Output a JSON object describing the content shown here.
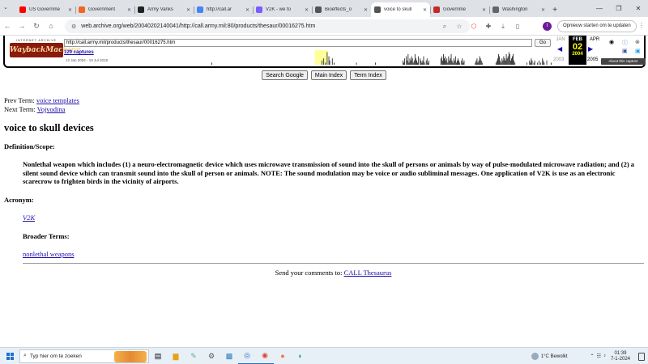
{
  "browser": {
    "tabs": [
      {
        "title": "US Governme",
        "color": "#ff0000",
        "active": false
      },
      {
        "title": "Government",
        "color": "#f26522",
        "active": false
      },
      {
        "title": "Army Vanks",
        "color": "#222222",
        "active": false
      },
      {
        "title": "http://call.ar",
        "color": "#4285f4",
        "active": false
      },
      {
        "title": "V2K - we to",
        "color": "#7b5cff",
        "active": false
      },
      {
        "title": "Bioeffects_o",
        "color": "#555555",
        "active": false
      },
      {
        "title": "voice to skull",
        "color": "#555555",
        "active": true
      },
      {
        "title": "Governme",
        "color": "#c62828",
        "active": false
      },
      {
        "title": "Washington",
        "color": "#666666",
        "active": false
      }
    ],
    "new_tab": "+",
    "address": "web.archive.org/web/20040202140041/http://call.army.mil:80/products/thesaur/00016275.htm",
    "update_button": "Opnieuw starten om te updaten",
    "avatar_letter": "I"
  },
  "wayback": {
    "logo_small": "INTERNET ARCHIVE",
    "logo_big": "WaybackMachine",
    "url_value": "http://call.army.mil/products/thesaur/00016275.htm",
    "go_label": "Go",
    "captures_label": "129 captures",
    "date_range": "12 Jan 2004 - 19 Jul 2018",
    "prev_month": "JAN",
    "current_month": "FEB",
    "current_day": "02",
    "current_year": "2004",
    "next_month": "APR",
    "prev_year": "2003",
    "next_year": "2005",
    "about_label": "About this capture",
    "sparkline": [
      1,
      0,
      0,
      0,
      0,
      0,
      0,
      0,
      0,
      0,
      0,
      0,
      0,
      0,
      0,
      0,
      0,
      0,
      0,
      0,
      0,
      0,
      0,
      0,
      0,
      0,
      0,
      0,
      0,
      0,
      0,
      0,
      0,
      0,
      0,
      0,
      0,
      0,
      0,
      0,
      0,
      0,
      0,
      0,
      0,
      0,
      0,
      0,
      0,
      0,
      0,
      0,
      0,
      0,
      0,
      0,
      0,
      0,
      0,
      0,
      0,
      0,
      0,
      0,
      0,
      0,
      0,
      0,
      0,
      0,
      0,
      0,
      0,
      0,
      0,
      0,
      0,
      0,
      0,
      0,
      0,
      0,
      0,
      0,
      0,
      0,
      0,
      0,
      0,
      0,
      0,
      0,
      0,
      0,
      0,
      0,
      0,
      0,
      0,
      0,
      0,
      0,
      0,
      0,
      0,
      0,
      0,
      0,
      0,
      0,
      0,
      0,
      0,
      0,
      0,
      0,
      0,
      0,
      0,
      0,
      0,
      0,
      0,
      0,
      0,
      0,
      0,
      0,
      2,
      0,
      3,
      0,
      1,
      0,
      6,
      0,
      4,
      2,
      0,
      0,
      3,
      0,
      1,
      0,
      0,
      0,
      0,
      0,
      0,
      0,
      0,
      0,
      0,
      0,
      0,
      0,
      0,
      0,
      0,
      0,
      0,
      0,
      0,
      0,
      0,
      0,
      0,
      0,
      1,
      0,
      0,
      0,
      0,
      0,
      0,
      0,
      0,
      0,
      0,
      0,
      0,
      0,
      0,
      0,
      0,
      0,
      0,
      0,
      0,
      0,
      1,
      0,
      0,
      0,
      0,
      0,
      0,
      0,
      0,
      0,
      0,
      0,
      0,
      0,
      0,
      0,
      0,
      0,
      0,
      0,
      0,
      0,
      0,
      0,
      0,
      0,
      0,
      0,
      0,
      0,
      0,
      0,
      2,
      1,
      3,
      0,
      4,
      2,
      5,
      1,
      3,
      2,
      4,
      3,
      1,
      2,
      5,
      3,
      2,
      1,
      4,
      0,
      3,
      2,
      1,
      2,
      4,
      1,
      0,
      2,
      3,
      1,
      2,
      0,
      0,
      0,
      0,
      0,
      0,
      0,
      0,
      0,
      0,
      0,
      0,
      0,
      3,
      4,
      2,
      5,
      3,
      4,
      2,
      3,
      1,
      4,
      2,
      3,
      5,
      2,
      1,
      3,
      2,
      4,
      1,
      2,
      3,
      2,
      1,
      0,
      2,
      3,
      1,
      2,
      0,
      0,
      0,
      0,
      0,
      0,
      0,
      0,
      0,
      0,
      0,
      0,
      1,
      2,
      3,
      1,
      2,
      4,
      3,
      2,
      1,
      0,
      0,
      0,
      0,
      0,
      0,
      0,
      0,
      0,
      0,
      0,
      0,
      0,
      0,
      0,
      1,
      2,
      3,
      5,
      4,
      2,
      1,
      3,
      2,
      4,
      3,
      2,
      5,
      3,
      4,
      6,
      5,
      2,
      3,
      4,
      5,
      2,
      1,
      0,
      0,
      0,
      0,
      0,
      0,
      0,
      0,
      0,
      0,
      0,
      0,
      0,
      1,
      0,
      0,
      2,
      1,
      3,
      2,
      0,
      1,
      2,
      0,
      0,
      1,
      0,
      2,
      0,
      1,
      0,
      3,
      2,
      1,
      0,
      0,
      2,
      0,
      0,
      0,
      0,
      1
    ],
    "highlight_index": 120
  },
  "page": {
    "buttons": {
      "search": "Search Google",
      "main_index": "Main Index",
      "term_index": "Term Index"
    },
    "prev_label": "Prev Term:",
    "prev_link": "voice templates",
    "next_label": "Next Term:",
    "next_link": "Vojvodina",
    "title": "voice to skull devices",
    "definition_label": "Definition/Scope:",
    "definition": "Nonlethal weapon which includes (1) a neuro-electromagnetic device which uses microwave transmission of sound into the skull of persons or animals by way of pulse-modulated microwave radiation; and (2) a silent sound device which can transmit sound into the skull of person or animals. NOTE: The sound modulation may be voice or audio subliminal messages. One application of V2K is use as an electronic scarecrow to frighten birds in the vicinity of airports.",
    "acronym_label": "Acronym:",
    "acronym": "V2K",
    "broader_label": "Broader Terms:",
    "broader": "nonlethal weapons",
    "comments_text": "Send your comments to:",
    "comments_link": "CALL Thesaurus"
  },
  "taskbar": {
    "search_placeholder": "Typ hier om te zoeken",
    "weather": "1°C  Bewolkt",
    "time": "01:39",
    "date": "7-1-2024"
  }
}
